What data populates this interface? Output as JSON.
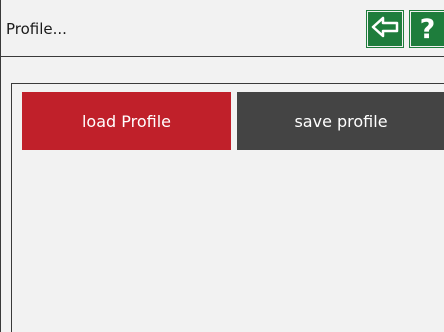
{
  "header": {
    "title": "Profile...",
    "back_icon": "back-arrow-icon",
    "help_label": "?"
  },
  "actions": {
    "load_label": "load Profile",
    "save_label": "save profile"
  },
  "colors": {
    "accent_green": "#1e7d3c",
    "load_red": "#c0202a",
    "save_gray": "#444444",
    "background": "#f2f2f2"
  }
}
